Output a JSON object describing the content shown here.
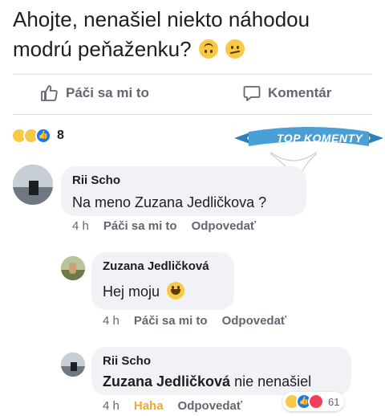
{
  "post": {
    "text": "Ahojte, nenašiel niekto náhodou modrú peňaženku?",
    "emoji_icons": [
      "upside-down-face-icon",
      "confused-face-icon"
    ]
  },
  "actions": {
    "like_label": "Páči sa mi to",
    "comment_label": "Komentár"
  },
  "reactions": {
    "icons": [
      "haha-icon",
      "sad-icon",
      "like-icon"
    ],
    "count": "8"
  },
  "banner": {
    "text": "TOP KOMENTY",
    "color": "#4a9fd4"
  },
  "comments": [
    {
      "author": "Rii Scho",
      "text": "Na meno Zuzana Jedličkova ?",
      "time": "4 h",
      "like_label": "Páči sa mi to",
      "reply_label": "Odpovedať"
    },
    {
      "author": "Zuzana Jedličková",
      "text": "Hej moju",
      "time": "4 h",
      "like_label": "Páči sa mi to",
      "reply_label": "Odpovedať"
    },
    {
      "author": "Rii Scho",
      "mention": "Zuzana Jedličková",
      "text": "nie nenašiel",
      "time": "4 h",
      "reaction_label": "Haha",
      "reply_label": "Odpovedať",
      "reaction_count": "61"
    }
  ],
  "colors": {
    "meta_text": "#606770",
    "haha": "#f0a92e",
    "like_blue": "#1877f2",
    "love_red": "#f33e58",
    "bubble": "#f0f2f5"
  }
}
